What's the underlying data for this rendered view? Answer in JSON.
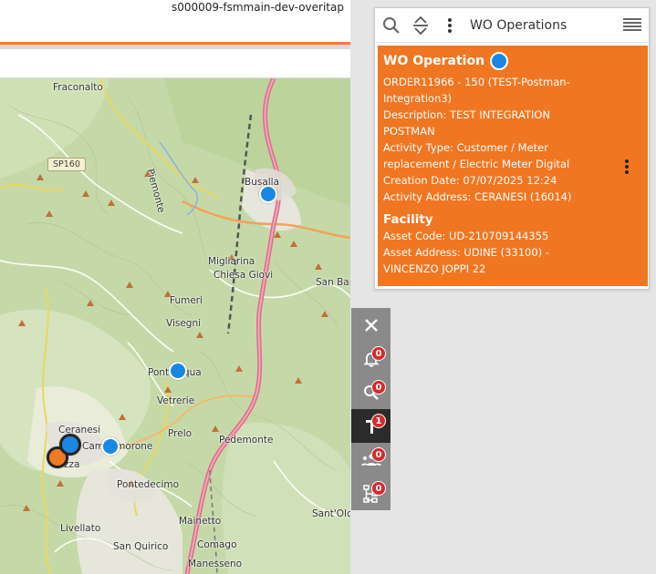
{
  "page": {
    "title": "s000009-fsmmain-dev-overitap"
  },
  "map": {
    "road_tag": "SP160",
    "labels": [
      {
        "id": "fraconalto",
        "text": "Fraconalto"
      },
      {
        "id": "piemonte",
        "text": "Piemonte"
      },
      {
        "id": "busalla",
        "text": "Busalla"
      },
      {
        "id": "migliarina",
        "text": "Migliarina"
      },
      {
        "id": "chiesa-giovi",
        "text": "Chiesa Giovi"
      },
      {
        "id": "san-bar",
        "text": "San Bar"
      },
      {
        "id": "fumeri",
        "text": "Fumeri"
      },
      {
        "id": "visegni",
        "text": "Visegni"
      },
      {
        "id": "pontinvrea",
        "text": "Pontinvqua"
      },
      {
        "id": "vetrerie",
        "text": "Vetrerie"
      },
      {
        "id": "prelo",
        "text": "Prelo"
      },
      {
        "id": "pedemonte",
        "text": "Pedemonte"
      },
      {
        "id": "ceranesi",
        "text": "Ceranesi"
      },
      {
        "id": "campomorone",
        "text": "Campomorone"
      },
      {
        "id": "zza",
        "text": "zza"
      },
      {
        "id": "pontedecimo",
        "text": "Pontedecimo"
      },
      {
        "id": "livellato",
        "text": "Livellato"
      },
      {
        "id": "mainetto",
        "text": "Mainetto"
      },
      {
        "id": "san-quirico",
        "text": "San Quirico"
      },
      {
        "id": "comago",
        "text": "Comago"
      },
      {
        "id": "santolc",
        "text": "Sant'Olc"
      },
      {
        "id": "manesseno",
        "text": "Manesseno"
      }
    ]
  },
  "panel": {
    "title": "WO Operations",
    "card": {
      "heading": "WO Operation",
      "lines": [
        "ORDER11966 - 150 (TEST-Postman-Integration3)",
        "Description: TEST INTEGRATION POSTMAN",
        "Activity Type: Customer / Meter replacement / Electric Meter Digital",
        "Creation Date: 07/07/2025 12:24",
        "Activity Address: CERANESI (16014)"
      ],
      "facility_heading": "Facility",
      "facility_lines": [
        "Asset Code: UD-210709144355",
        "Asset Address: UDINE (33100) - VINCENZO JOPPI 22"
      ]
    }
  },
  "toolbar": {
    "badges": {
      "notifications": "0",
      "search": "0",
      "work": "1",
      "team": "0",
      "tree": "0"
    }
  },
  "colors": {
    "accent": "#f07621",
    "marker_blue": "#1a88e2",
    "marker_orange": "#ef7a22",
    "badge_red": "#d42b2b"
  },
  "icons": [
    "search-icon",
    "expand-collapse-icon",
    "more-vert-icon",
    "hamburger-menu-icon",
    "close-icon",
    "bell-icon",
    "search-icon",
    "work-order-icon",
    "team-icon",
    "hierarchy-icon"
  ]
}
